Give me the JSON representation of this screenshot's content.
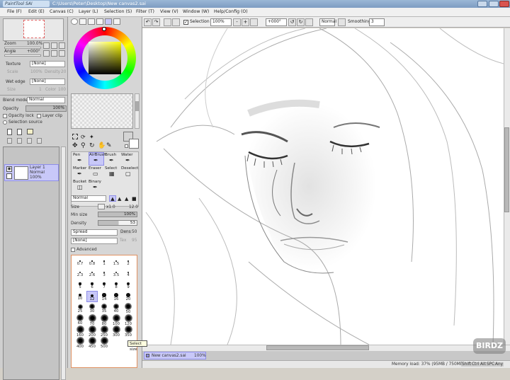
{
  "titlebar": {
    "app_logo": "PaintTool SAI",
    "title": "C:\\Users\\Peter\\Desktop\\New canvas2.sai"
  },
  "menu": [
    "File (F)",
    "Edit (E)",
    "Canvas (C)",
    "Layer (L)",
    "Selection (S)",
    "Filter (T)",
    "View (V)",
    "Window (W)",
    "Help/Config (O)"
  ],
  "navigator": {
    "zoom_label": "Zoom",
    "zoom_value": "100.0%",
    "angle_label": "Angle",
    "angle_value": "+000°"
  },
  "texture": {
    "label": "Texture",
    "value": "[None]",
    "scale_label": "Scale",
    "scale_value": "100%",
    "density_label": "Density",
    "density_value": "20"
  },
  "wet_edge": {
    "label": "Wet edge",
    "value": "[None]",
    "size_label": "Size",
    "size_value": "1",
    "color_label": "Color",
    "color_value": "100"
  },
  "layer_props": {
    "blend_mode_label": "Blend mode",
    "blend_mode_value": "Normal",
    "opacity_label": "Opacity",
    "opacity_value": "100%",
    "opacity_lock": "Opacity lock",
    "layer_clip": "Layer clip",
    "selection_source": "Selection source"
  },
  "layer": {
    "name": "Layer 1",
    "mode": "Normal",
    "opacity": "100%"
  },
  "toolbar": {
    "selection_label": "Selection",
    "selection_checked": true,
    "zoom_value": "100%",
    "angle_value": "+000°",
    "mode_value": "Normal",
    "smoothing_label": "Smoothing",
    "smoothing_value": "3"
  },
  "tools": [
    "Pen",
    "AirBrush",
    "Brush",
    "Water",
    "Marker",
    "Eraser",
    "Select",
    "Deselect",
    "Bucket",
    "Binary"
  ],
  "brush": {
    "mode_value": "Normal",
    "size_label": "Size",
    "size_multiplier": "x1.0",
    "size_value": "12.0",
    "min_size_label": "Min size",
    "min_size_value": "100%",
    "density_label": "Density",
    "density_value": "53",
    "shape_value": "Spread",
    "shape_amount_label": "Dens",
    "shape_amount_value": "50",
    "texture_value": "[None]",
    "texture_amount_label": "Tex",
    "texture_amount_value": "95",
    "advanced_label": "Advanced"
  },
  "brush_sizes": [
    "0.7",
    "0.8",
    "1",
    "1.5",
    "2",
    "2.3",
    "2.6",
    "3",
    "3.5",
    "4",
    "5",
    "6",
    "7",
    "8",
    "9",
    "10",
    "12",
    "14",
    "16",
    "20",
    "25",
    "30",
    "35",
    "40",
    "50",
    "60",
    "70",
    "80",
    "100",
    "120",
    "160",
    "200",
    "250",
    "300",
    "350",
    "400",
    "450",
    "500"
  ],
  "tooltip": "Select size",
  "tab": {
    "name": "New canvas2.sai",
    "zoom": "100%"
  },
  "status": {
    "memory": "Memory load: 37% (95MB / 750MB)",
    "keys": [
      "Shift",
      "Ctrl",
      "Alt",
      "SPC",
      "Any"
    ]
  },
  "watermark": "BIRDZ",
  "colors": {
    "accent": "#8e8ee8",
    "panel": "#d4d0c8",
    "selected": "#c8c8f8"
  }
}
